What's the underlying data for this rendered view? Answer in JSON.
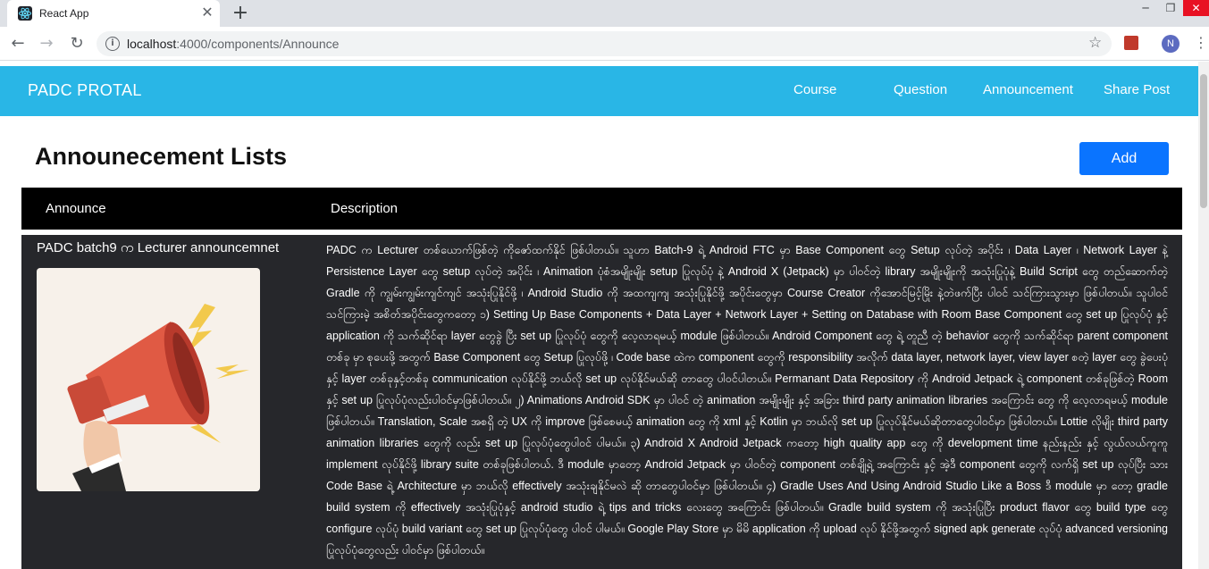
{
  "browser": {
    "tab_title": "React App",
    "tab_close_icon": "close-icon",
    "new_tab_icon": "plus-icon",
    "url_host": "localhost",
    "url_path": ":4000/components/Announce",
    "profile_initial": "N"
  },
  "navbar": {
    "brand": "PADC PROTAL",
    "links": [
      "Course",
      "Question",
      "Announcement",
      "Share Post"
    ],
    "color": "#29b6e6"
  },
  "page": {
    "title": "Announecement Lists",
    "add_button": "Add",
    "add_button_color": "#0a74ff"
  },
  "table": {
    "headers": [
      "Announce",
      "Description"
    ],
    "rows": [
      {
        "title": "PADC batch9 က Lecturer announcemnet",
        "image_icon": "megaphone-icon",
        "description": "PADC က Lecturer တစ်ယောက်ဖြစ်တဲ့ ကိုဇော်ထက်နိုင် ဖြစ်ပါတယ်။ သူဟာ Batch-9 ရဲ့ Android FTC မှာ Base Component တွေ Setup လုပ်တဲ့ အပိုင်း ၊ Data Layer ၊ Network Layer နဲ့ Persistence Layer တွေ setup လုပ်တဲ့ အပိုင်း ၊ Animation ပုံစံအမျိုးမျိုး setup ပြုလုပ်ပုံ နဲ့ Android X (Jetpack) မှာ ပါဝင်တဲ့ library အမျိုးမျိုးကို အသုံးပြုပုံနဲ့ Build Script တွေ တည်ဆောက်တဲ့ Gradle ကို ကျွမ်းကျွမ်းကျင်ကျင် အသုံးပြုနိုင်ဖို့ ၊ Android Studio ကို အထကျကျ အသုံးပြုနိုင်ဖို့ အပိုင်းတွေမှာ Course Creator ကိုအောင်မြင့်မြိုး နဲ့တဲဖက်ပြီး ပါဝင် သင်ကြားသွားမှာ ဖြစ်ပါတယ်။ သူပါဝင်သင်ကြားမဲ့ အစိတ်အပိုင်းတွေကတော့ ၁) Setting Up Base Components + Data Layer + Network Layer + Setting on Database with Room Base Component တွေ set up ပြုလုပ်ပုံ နှင့် application ကို သက်ဆိုင်ရာ layer တွေခွဲ ပြီး set up ပြုလုပ်ပုံ တွေကို လေ့လာရမယ့် module ဖြစ်ပါတယ်။ Android Component တွေ ရဲ့ တူညီ တဲ့ behavior တွေကို သက်ဆိုင်ရာ parent component တစ်ခု မှာ စုပေးဖို့ အတွက် Base Component တွေ Setup ပြုလုပ်ဖို့ ၊ Code base ထဲက component တွေကို responsibility အလိုက် data layer, network layer, view layer စတဲ့ layer တွေ ခွဲပေးပုံနှင့် layer တစ်ခုနှင့်တစ်ခု communication လုပ်နိုင်ဖို့ ဘယ်လို set up လုပ်နိုင်မယ်ဆို တာတွေ ပါဝင်ပါတယ်။ Permanant Data Repository ကို Android Jetpack ရဲ့ component တစ်ခုဖြစ်တဲ့ Room နှင့် set up ပြုလုပ်ပုံလည်းပါဝင်မှာဖြစ်ပါတယ်။ ၂) Animations Android SDK မှာ ပါဝင် တဲ့ animation အမျိုးမျိုး နှင့် အခြား third party animation libraries အကြောင်း တွေ ကို လေ့လာရမယ့် module ဖြစ်ပါတယ်။ Translation, Scale အစရှိ တဲ့ UX ကို improve ဖြစ်စေမယ့် animation တွေ ကို xml နှင့် Kotlin မှာ ဘယ်လို set up ပြုလုပ်နိုင်မယ်ဆိုတာတွေပါဝင်မှာ ဖြစ်ပါတယ်။ Lottie လိုမျိုး third party animation libraries တွေကို လည်း set up ပြုလုပ်ပုံတွေပါဝင် ပါမယ်။ ၃) Android X Android Jetpack ကတော့ high quality app တွေ ကို development time နည်းနည်း နှင့် လွယ်လယ်ကူကူ implement လုပ်နိုင်ဖို့ library suite တစ်ခုဖြစ်ပါတယ်. ဒီ module မှာတော့ Android Jetpack မှာ ပါဝင်တဲ့ component တစ်ချို့ရဲ့ အကြောင်း နှင့် အဲ့ဒီ component တွေကို လက်ရှိ set up လုပ်ပြီး သား Code Base ရဲ့ Architecture မှာ ဘယ်လို effectively အသုံးချနိုင်မလဲ ဆို တာတွေပါဝင်မှာ ဖြစ်ပါတယ်။ ၄) Gradle Uses And Using Android Studio Like a Boss ဒီ module မှာ တော့ gradle build system ကို effectively အသုံးပြုပုံနှင့် android studio ရဲ့ tips and tricks လေးတွေ အကြောင်း ဖြစ်ပါတယ်။ Gradle build system ကို အသုံးပြုပြီး product flavor တွေ build type တွေ configure လုပ်ပုံ build variant တွေ set up ပြုလုပ်ပုံတွေ ပါဝင် ပါမယ်။ Google Play Store မှာ မိမိ application ကို upload လုပ် နိုင်ဖို့အတွက် signed apk generate လုပ်ပုံ advanced versioning ပြုလုပ်ပုံတွေလည်း ပါဝင်မှာ ဖြစ်ပါတယ်။"
      }
    ]
  }
}
